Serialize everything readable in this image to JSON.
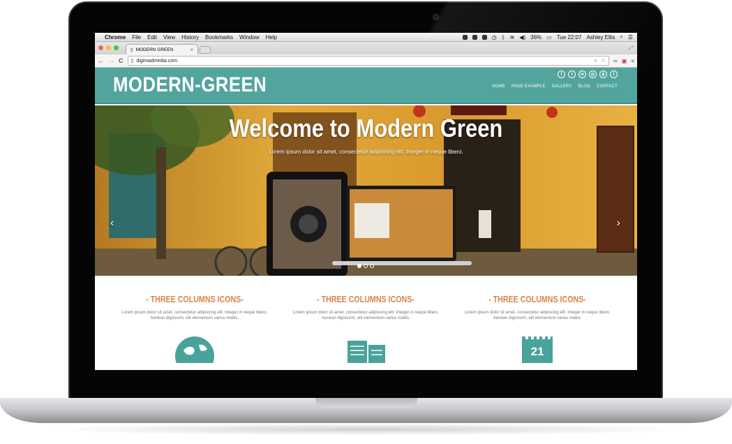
{
  "mac_menubar": {
    "apple": "",
    "items": [
      "Chrome",
      "File",
      "Edit",
      "View",
      "History",
      "Bookmarks",
      "Window",
      "Help"
    ],
    "battery": "36%",
    "clock": "Tue 22:07",
    "user": "Ashley Ellis"
  },
  "browser": {
    "tab_title": "MODERN GREEN",
    "tab_close": "×",
    "url": "digimadmedia.com",
    "back": "←",
    "forward": "→",
    "reload": "C"
  },
  "site": {
    "logo": "MODERN-GREEN",
    "social": [
      "f",
      "t",
      "in",
      "◎",
      "♟",
      "t"
    ],
    "nav": [
      "HOME",
      "PAGE EXAMPLE",
      "GALLERY",
      "BLOG",
      "CONTACT"
    ],
    "hero_title": "Welcome to Modern Green",
    "hero_subtitle": "Lorem ipsum dolor sit amet, consectetur adipiscing elit. Integer in neque libero.",
    "prev_arrow": "‹",
    "next_arrow": "›",
    "columns": [
      {
        "title": "- THREE COLUMNS ICONS-",
        "text": "Lorem ipsum dolor sit amet, consectetur adipiscing elit. Integer in neque libero. Aenean dignissim, elit elementum varius mattis.",
        "icon": "globe-icon"
      },
      {
        "title": "- THREE COLUMNS ICONS-",
        "text": "Lorem ipsum dolor sit amet, consectetur adipiscing elit. Integer in neque libero. Aenean dignissim, elit elementum varius mattis.",
        "icon": "documents-icon"
      },
      {
        "title": "- THREE COLUMNS ICONS-",
        "text": "Lorem ipsum dolor sit amet, consectetur adipiscing elit. Integer in neque libero. Aenean dignissim, elit elementum varius mattis.",
        "icon": "calendar-icon"
      }
    ],
    "calendar_day": "21"
  },
  "colors": {
    "header": "#52a59c",
    "accent": "#d9844a",
    "icon": "#4aa39b"
  }
}
